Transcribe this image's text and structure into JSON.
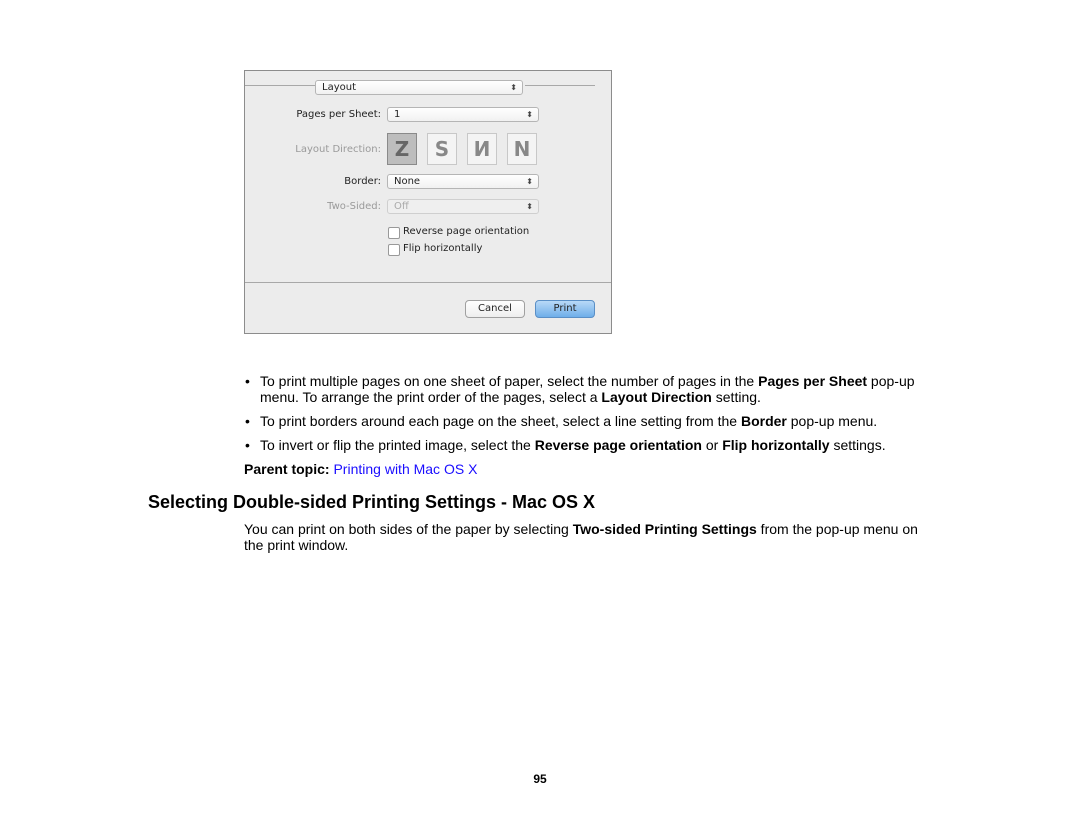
{
  "dialog": {
    "panel_select": "Layout",
    "pages_per_sheet": {
      "label": "Pages per Sheet:",
      "value": "1"
    },
    "layout_direction": {
      "label": "Layout Direction:",
      "options": [
        "Z",
        "S",
        "N-reversed",
        "N"
      ],
      "selected": 0
    },
    "border": {
      "label": "Border:",
      "value": "None"
    },
    "two_sided": {
      "label": "Two-Sided:",
      "value": "Off",
      "disabled": true
    },
    "reverse": {
      "label": "Reverse page orientation",
      "checked": false
    },
    "flip": {
      "label": "Flip horizontally",
      "checked": false
    },
    "cancel": "Cancel",
    "print": "Print"
  },
  "bullets": [
    {
      "pre": "To print multiple pages on one sheet of paper, select the number of pages in the ",
      "b1": "Pages per Sheet",
      "mid": " pop-up menu. To arrange the print order of the pages, select a ",
      "b2": "Layout Direction",
      "post": " setting."
    },
    {
      "pre": "To print borders around each page on the sheet, select a line setting from the ",
      "b1": "Border",
      "post": " pop-up menu."
    },
    {
      "pre": "To invert or flip the printed image, select the ",
      "b1": "Reverse page orientation",
      "mid": " or ",
      "b2": "Flip horizontally",
      "post": " settings."
    }
  ],
  "parent_topic": {
    "label": "Parent topic:",
    "link": "Printing with Mac OS X"
  },
  "heading": "Selecting Double-sided Printing Settings - Mac OS X",
  "para": {
    "pre": "You can print on both sides of the paper by selecting ",
    "b": "Two-sided Printing Settings",
    "post": " from the pop-up menu on the print window."
  },
  "page_number": "95",
  "colors": {
    "link": "#1a0dff",
    "print_button": "#6faee9"
  }
}
